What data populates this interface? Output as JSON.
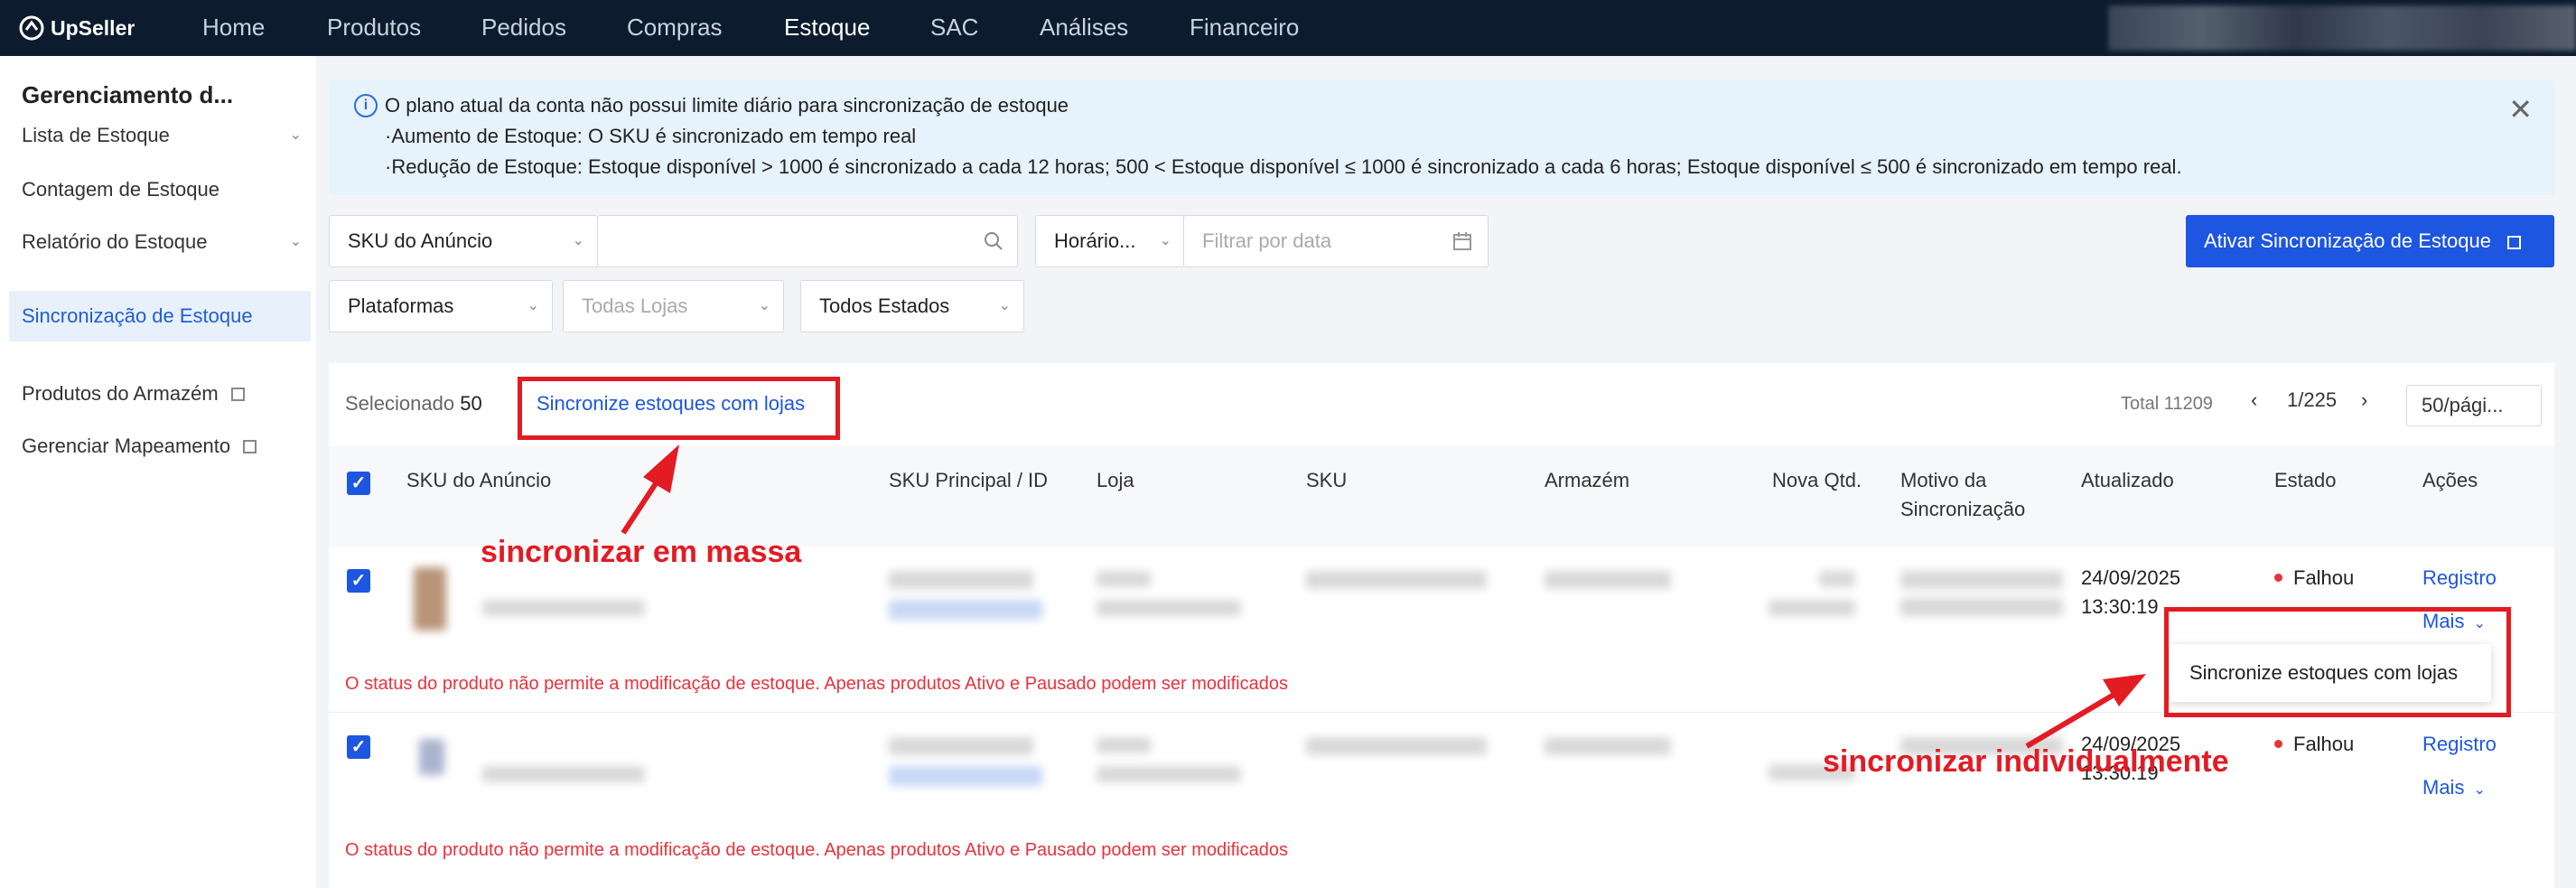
{
  "app": {
    "brand": "UpSeller"
  },
  "nav": {
    "items": [
      "Home",
      "Produtos",
      "Pedidos",
      "Compras",
      "Estoque",
      "SAC",
      "Análises",
      "Financeiro"
    ],
    "active": "Estoque"
  },
  "sidebar": {
    "title": "Gerenciamento d...",
    "items": [
      {
        "label": "Lista de Estoque"
      },
      {
        "label": "Contagem de Estoque"
      },
      {
        "label": "Relatório do Estoque"
      },
      {
        "label": "Sincronização de Estoque"
      },
      {
        "label": "Produtos do Armazém"
      },
      {
        "label": "Gerenciar Mapeamento"
      }
    ]
  },
  "banner": {
    "line1": "O plano atual da conta não possui limite diário para sincronização de estoque",
    "line2": "·Aumento de Estoque: O SKU é sincronizado em tempo real",
    "line3": "·Redução de Estoque: Estoque disponível > 1000 é sincronizado a cada 12 horas; 500 < Estoque disponível ≤ 1000 é sincronizado a cada 6 horas; Estoque disponível ≤ 500 é sincronizado em tempo real."
  },
  "filters": {
    "sku_type": "SKU do Anúncio",
    "search_value": "",
    "time_type": "Horário...",
    "date_placeholder": "Filtrar por data",
    "platforms": "Plataformas",
    "stores_placeholder": "Todas Lojas",
    "states": "Todos Estados"
  },
  "actions": {
    "activate_sync": "Ativar Sincronização de Estoque"
  },
  "table_toolbar": {
    "selected_label": "Selecionado",
    "selected_count": "50",
    "bulk_sync": "Sincronize estoques com lojas",
    "total": "Total 11209",
    "page": "1/225",
    "page_size": "50/pági..."
  },
  "table": {
    "columns": [
      "SKU do Anúncio",
      "SKU Principal / ID",
      "Loja",
      "SKU",
      "Armazém",
      "Nova Qtd.",
      "Motivo da Sincronização",
      "Atualizado",
      "Estado",
      "Ações"
    ],
    "rows": [
      {
        "updated_date": "24/09/2025",
        "updated_time": "13:30:19",
        "state": "Falhou",
        "action_log": "Registro",
        "action_more": "Mais",
        "error": "O status do produto não permite a modificação de estoque. Apenas produtos Ativo e Pausado podem ser modificados"
      },
      {
        "updated_date": "24/09/2025",
        "updated_time": "13:30:19",
        "state": "Falhou",
        "action_log": "Registro",
        "action_more": "Mais",
        "error": "O status do produto não permite a modificação de estoque. Apenas produtos Ativo e Pausado podem ser modificados"
      }
    ]
  },
  "dropdown": {
    "item": "Sincronize estoques com lojas"
  },
  "annotations": {
    "bulk": "sincronizar em massa",
    "individual": "sincronizar individualmente"
  },
  "colors": {
    "nav_bg": "#0d1b2e",
    "primary": "#1d56e0",
    "error": "#e8323c",
    "annotation": "#e31b23"
  }
}
